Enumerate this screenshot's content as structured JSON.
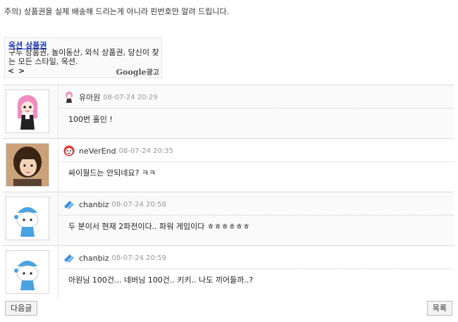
{
  "notice": "주의) 상품권을 실제 배송해 드리는게 아니라 핀번호만 알려 드립니다.",
  "ad": {
    "title": "옥션 상품권",
    "body": "구두 상품권, 놀이동산, 외식 상품권, 당신이 찾는 모든 스타일, 옥션.",
    "nav": "< >",
    "google": "Google",
    "google_suffix": "광고"
  },
  "comments": [
    {
      "name": "유아원",
      "date": "08-07-24 20:29",
      "text": "100번 홀인 !",
      "avatar": "pink-hair-girl",
      "icon": "girl-icon"
    },
    {
      "name": "neVerEnd",
      "date": "08-07-24 20:35",
      "text": "싸이월드는 안되네요?  ㅋㅋ",
      "avatar": "photo-person",
      "icon": "red-face-icon"
    },
    {
      "name": "chanbiz",
      "date": "08-07-24 20:58",
      "text": "두 분이서 현재 2파전이다.. 파워 게임이다 ㅎㅎㅎㅎㅎㅎ",
      "avatar": "blue-beanie-character",
      "icon": "blue-stripes-icon"
    },
    {
      "name": "chanbiz",
      "date": "08-07-24 20:59",
      "text": "아원님 100건... 네버님 100건.. 키키.. 나도 끼어들까..?",
      "avatar": "blue-beanie-character",
      "icon": "blue-stripes-icon"
    }
  ],
  "buttons": {
    "next": "다음글",
    "list": "목록"
  }
}
